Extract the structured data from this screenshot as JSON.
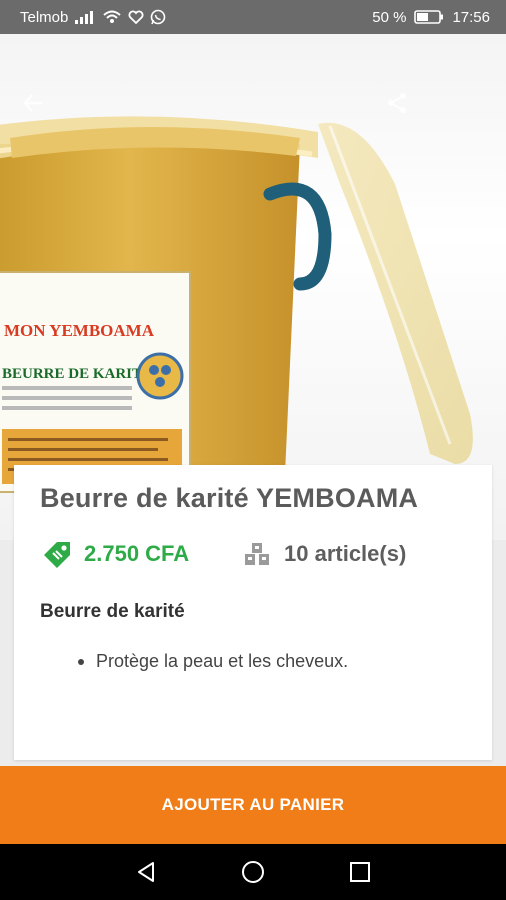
{
  "status_bar": {
    "carrier": "Telmob",
    "battery": "50 %",
    "time": "17:56",
    "icons": [
      "signal-icon",
      "wifi-icon",
      "heart-icon",
      "whatsapp-icon",
      "battery-icon"
    ]
  },
  "hero": {
    "image": "shea-butter-bucket",
    "label_brand": "MON YEMBOAMA",
    "label_product": "BEURRE DE KARITE",
    "back_icon": "arrow-back-icon",
    "share_icon": "share-icon"
  },
  "product": {
    "title": "Beurre de karité YEMBOAMA",
    "price": "2.750 CFA",
    "price_icon": "price-tag-icon",
    "stock": "10 article(s)",
    "stock_icon": "stock-boxes-icon",
    "description_heading": "Beurre de karité",
    "description_items": [
      "Protège la peau et les cheveux."
    ]
  },
  "cart": {
    "button_label": "AJOUTER AU PANIER"
  },
  "nav": {
    "icons": [
      "nav-back-icon",
      "nav-home-icon",
      "nav-recents-icon"
    ]
  },
  "colors": {
    "accent": "#f07d17",
    "price_green": "#2eaa47",
    "status_bar": "#6b6b6b"
  }
}
